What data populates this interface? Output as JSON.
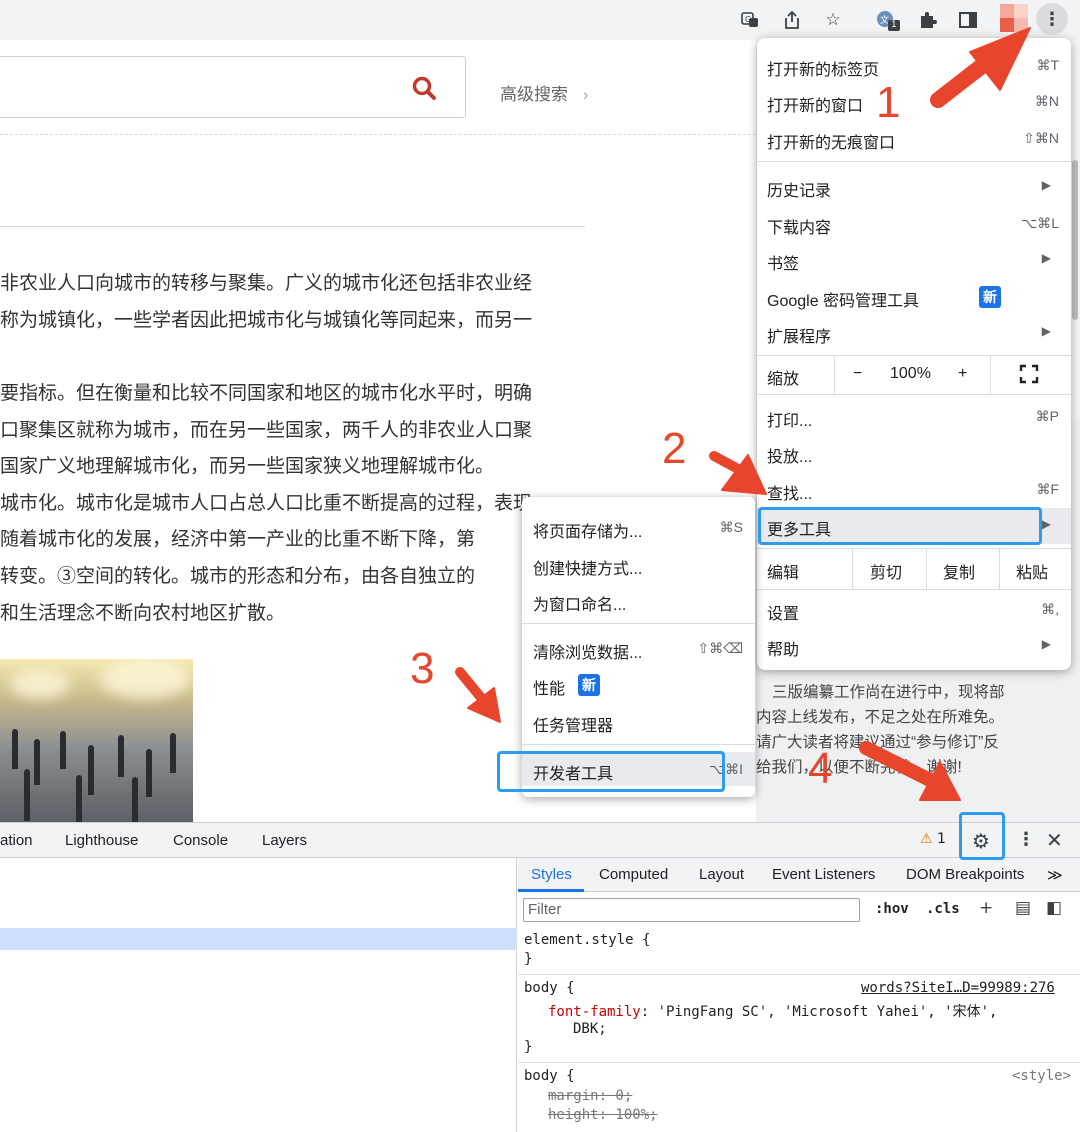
{
  "toolbar": {
    "icons": [
      "translate-icon",
      "share-icon",
      "bookmark-star-icon",
      "extension-icon",
      "puzzle-icon",
      "side-panel-icon",
      "profile-avatar",
      "more-vert-icon"
    ],
    "extension_badge": "1"
  },
  "page": {
    "advanced_search": "高级搜索",
    "article_lines": [
      "非农业人口向城市的转移与聚集。广义的城市化还包括非农业经",
      "称为城镇化，一些学者因此把城市化与城镇化等同起来，而另一",
      "要指标。但在衡量和比较不同国家和地区的城市化水平时，明确",
      "口聚集区就称为城市，而在另一些国家，两千人的非农业人口聚",
      "国家广义地理解城市化，而另一些国家狭义地理解城市化。",
      "城市化。城市化是城市人口占总人口比重不断提高的过程，表现",
      "随着城市化的发展，经济中第一产业的比重不断下降，第",
      "转变。③空间的转化。城市的形态和分布，由各自独立的",
      "和生活理念不断向农村地区扩散。"
    ],
    "side_lines": [
      "三版编纂工作尚在进行中，现将部",
      "内容上线发布，不足之处在所难免。",
      "请广大读者将建议通过“参与修订”反",
      "给我们，以便不断完善。谢谢!"
    ]
  },
  "menu": {
    "new_tab": "打开新的标签页",
    "new_tab_sc": "⌘T",
    "new_window": "打开新的窗口",
    "new_window_sc": "⌘N",
    "incognito": "打开新的无痕窗口",
    "incognito_sc": "⇧⌘N",
    "history": "历史记录",
    "downloads": "下载内容",
    "downloads_sc": "⌥⌘L",
    "bookmarks": "书签",
    "password_manager": "Google 密码管理工具",
    "new_badge": "新",
    "extensions": "扩展程序",
    "zoom": "缩放",
    "zoom_minus": "−",
    "zoom_level": "100%",
    "zoom_plus": "+",
    "print": "打印...",
    "print_sc": "⌘P",
    "cast": "投放...",
    "find": "查找...",
    "find_sc": "⌘F",
    "more_tools": "更多工具",
    "edit": "编辑",
    "cut": "剪切",
    "copy": "复制",
    "paste": "粘贴",
    "settings": "设置",
    "settings_sc": "⌘,",
    "help": "帮助"
  },
  "submenu": {
    "save_page": "将页面存储为...",
    "save_page_sc": "⌘S",
    "create_shortcut": "创建快捷方式...",
    "name_window": "为窗口命名...",
    "clear_data": "清除浏览数据...",
    "clear_data_sc": "⇧⌘⌫",
    "performance": "性能",
    "new_badge": "新",
    "task_manager": "任务管理器",
    "dev_tools": "开发者工具",
    "dev_tools_sc": "⌥⌘I"
  },
  "devtools": {
    "tabs": [
      "ation",
      "Lighthouse",
      "Console",
      "Layers"
    ],
    "warning_count": "1",
    "styles_tabs": [
      "Styles",
      "Computed",
      "Layout",
      "Event Listeners",
      "DOM Breakpoints",
      "≫"
    ],
    "filter_placeholder": "Filter",
    "hov": ":hov",
    "cls": ".cls",
    "element_style": "element.style {",
    "brace_close": "}",
    "body_rule": "body {",
    "body_source": "words?SiteI…D=99989:276",
    "font_family_prop": "font-family",
    "font_family_val": ": 'PingFang SC', 'Microsoft Yahei', '宋体',",
    "font_family_val2": "DBK;",
    "body_rule2": "body {",
    "style_source": "<style>",
    "margin_decl": "margin: 0;",
    "height_decl": "height: 100%;"
  },
  "annotations": {
    "step1": "1",
    "step2": "2",
    "step3": "3",
    "step4": "4"
  },
  "colors": {
    "annotation_red": "#e8452d",
    "annotation_blue": "#2d9cf0",
    "badge_blue": "#1a73e8"
  }
}
